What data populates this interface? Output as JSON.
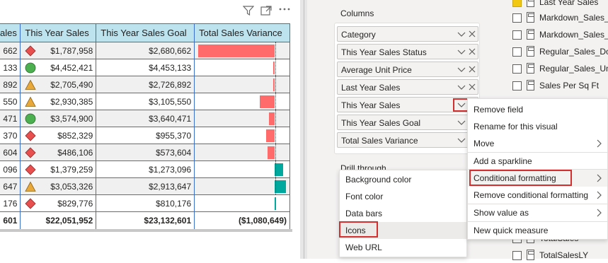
{
  "table": {
    "headers": [
      "ales",
      "This Year Sales",
      "This Year Sales Goal",
      "Total Sales Variance"
    ],
    "rows": [
      {
        "partial": "662",
        "icon": "red-diamond",
        "sales": "$1,787,958",
        "goal": "$2,680,662",
        "variance": -892704
      },
      {
        "partial": "133",
        "icon": "green-circle",
        "sales": "$4,452,421",
        "goal": "$4,453,133",
        "variance": -712
      },
      {
        "partial": "892",
        "icon": "yellow-triangle",
        "sales": "$2,705,490",
        "goal": "$2,726,892",
        "variance": -21402
      },
      {
        "partial": "550",
        "icon": "yellow-triangle",
        "sales": "$2,930,385",
        "goal": "$3,105,550",
        "variance": -175165
      },
      {
        "partial": "471",
        "icon": "green-circle",
        "sales": "$3,574,900",
        "goal": "$3,640,471",
        "variance": -65571
      },
      {
        "partial": "370",
        "icon": "red-diamond",
        "sales": "$852,329",
        "goal": "$955,370",
        "variance": -103041
      },
      {
        "partial": "604",
        "icon": "red-diamond",
        "sales": "$486,106",
        "goal": "$573,604",
        "variance": -87498
      },
      {
        "partial": "096",
        "icon": "red-diamond",
        "sales": "$1,379,259",
        "goal": "$1,273,096",
        "variance": 106163
      },
      {
        "partial": "647",
        "icon": "yellow-triangle",
        "sales": "$3,053,326",
        "goal": "$2,913,647",
        "variance": 139679
      },
      {
        "partial": "176",
        "icon": "red-diamond",
        "sales": "$829,776",
        "goal": "$810,176",
        "variance": 19600
      }
    ],
    "total": {
      "partial": "601",
      "sales": "$22,051,952",
      "goal": "$23,132,601",
      "variance": "($1,080,649)"
    }
  },
  "visual_header": {
    "filter_icon": "filter-icon",
    "focus_icon": "focus-mode-icon",
    "more_icon": "more-options-icon"
  },
  "pane": {
    "columns_title": "Columns",
    "drill_title": "Drill through",
    "wells": [
      "Category",
      "This Year Sales Status",
      "Average Unit Price",
      "Last Year Sales",
      "This Year Sales",
      "This Year Sales Goal",
      "Total Sales Variance"
    ]
  },
  "field_list": [
    {
      "label": "Last Year Sales",
      "checked": true
    },
    {
      "label": "Markdown_Sales_D",
      "checked": false
    },
    {
      "label": "Markdown_Sales_U",
      "checked": false
    },
    {
      "label": "Regular_Sales_Doll",
      "checked": false
    },
    {
      "label": "Regular_Sales_Unit",
      "checked": false
    },
    {
      "label": "Sales Per Sq Ft",
      "checked": false
    },
    {
      "label": "TotalSales",
      "checked": false
    },
    {
      "label": "TotalSalesLY",
      "checked": false
    }
  ],
  "context_menu": {
    "items": [
      "Remove field",
      "Rename for this visual",
      "Move",
      "Add a sparkline",
      "Conditional formatting",
      "Remove conditional formatting",
      "Show value as",
      "New quick measure"
    ]
  },
  "submenu": {
    "items": [
      "Background color",
      "Font color",
      "Data bars",
      "Icons",
      "Web URL"
    ]
  },
  "colors": {
    "header_bg": "#bde3ee",
    "grid": "#3b6fc9",
    "negative_bar": "#ff6b6b",
    "positive_bar": "#00a89d",
    "highlight_border": "#d32f2f"
  }
}
